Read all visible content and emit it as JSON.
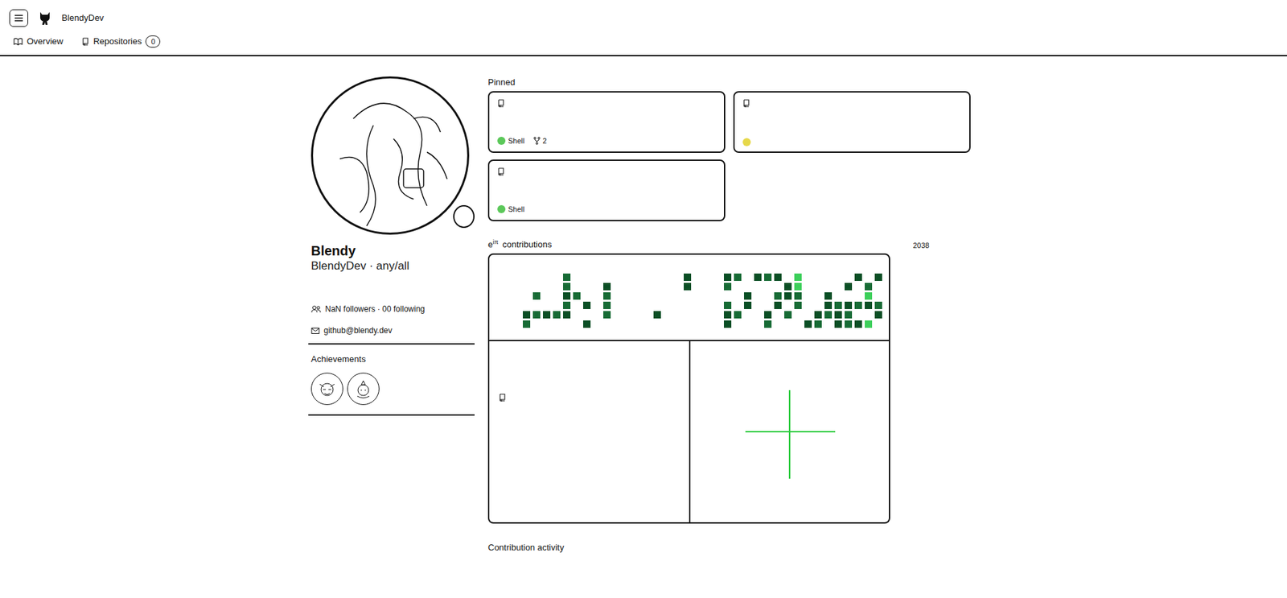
{
  "header": {
    "username": "BlendyDev"
  },
  "tabs": [
    {
      "label": "Overview",
      "selected": true
    },
    {
      "label": "Repositories",
      "count": "0",
      "selected": false
    }
  ],
  "profile": {
    "name": "Blendy",
    "subtitle": "BlendyDev · any/all",
    "follow_line": "NaN followers · 00 following",
    "email": "github@blendy.dev"
  },
  "achievements": {
    "title": "Achievements"
  },
  "pinned": {
    "title": "Pinned",
    "repos": [
      {
        "language": "Shell",
        "color": "#5cc85a",
        "forks": "2"
      },
      {
        "color": "#e6d84a"
      },
      {
        "language": "Shell",
        "color": "#5cc85a"
      }
    ]
  },
  "contributions": {
    "base": "e",
    "exponent": "iπ",
    "label": "contributions",
    "year": "2038",
    "grid": [
      [
        0,
        0,
        0,
        0,
        2,
        0,
        0,
        0,
        0,
        0,
        0,
        0,
        0,
        0,
        0,
        0,
        1,
        0,
        0,
        0,
        1,
        2,
        0,
        1,
        2,
        1,
        0,
        3,
        0,
        0,
        0,
        0,
        0,
        1,
        0,
        1
      ],
      [
        0,
        0,
        0,
        0,
        2,
        0,
        0,
        0,
        1,
        0,
        0,
        0,
        0,
        0,
        0,
        0,
        1,
        0,
        0,
        0,
        2,
        0,
        0,
        0,
        0,
        0,
        1,
        3,
        0,
        0,
        0,
        0,
        1,
        0,
        2,
        0
      ],
      [
        0,
        2,
        0,
        0,
        1,
        2,
        0,
        0,
        2,
        0,
        0,
        0,
        0,
        0,
        0,
        0,
        0,
        0,
        0,
        0,
        0,
        0,
        1,
        0,
        0,
        2,
        1,
        2,
        0,
        0,
        1,
        0,
        0,
        0,
        3,
        0
      ],
      [
        0,
        0,
        0,
        0,
        2,
        0,
        1,
        0,
        2,
        0,
        0,
        0,
        0,
        0,
        0,
        0,
        0,
        0,
        0,
        0,
        2,
        0,
        1,
        0,
        0,
        1,
        0,
        2,
        0,
        0,
        1,
        2,
        1,
        2,
        1,
        2
      ],
      [
        1,
        2,
        1,
        2,
        1,
        0,
        0,
        0,
        2,
        0,
        0,
        0,
        0,
        1,
        0,
        0,
        0,
        0,
        0,
        0,
        1,
        2,
        0,
        0,
        1,
        0,
        2,
        0,
        0,
        1,
        2,
        1,
        2,
        0,
        0,
        1
      ],
      [
        2,
        0,
        0,
        0,
        0,
        0,
        1,
        0,
        0,
        0,
        0,
        0,
        0,
        0,
        0,
        0,
        0,
        0,
        0,
        0,
        1,
        0,
        0,
        0,
        2,
        0,
        0,
        0,
        1,
        2,
        0,
        1,
        2,
        1,
        3,
        0
      ]
    ]
  },
  "activity": {
    "title": "Contribution activity"
  }
}
